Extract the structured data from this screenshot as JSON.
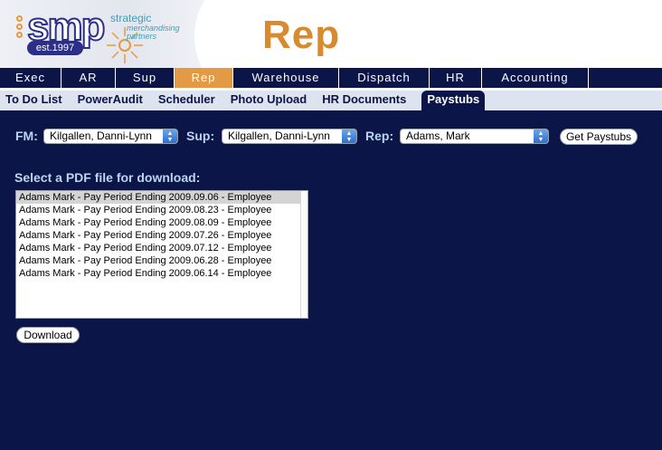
{
  "logo": {
    "brand": "smp",
    "established": "est.1997",
    "tagline_1": "strategic",
    "tagline_2": "merchandising",
    "tagline_3": "partners"
  },
  "page_title": "Rep",
  "top_nav": {
    "tabs": [
      {
        "label": "Exec"
      },
      {
        "label": "AR"
      },
      {
        "label": "Sup"
      },
      {
        "label": "Rep",
        "active": true
      },
      {
        "label": "Warehouse"
      },
      {
        "label": "Dispatch"
      },
      {
        "label": "HR"
      },
      {
        "label": "Accounting"
      }
    ]
  },
  "sub_nav": {
    "tabs": [
      {
        "label": "To Do List"
      },
      {
        "label": "PowerAudit"
      },
      {
        "label": "Scheduler"
      },
      {
        "label": "Photo Upload"
      },
      {
        "label": "HR Documents"
      },
      {
        "label": "Paystubs",
        "active": true
      }
    ]
  },
  "filters": {
    "fm_label": "FM:",
    "fm_value": "Kilgallen, Danni-Lynn",
    "sup_label": "Sup:",
    "sup_value": "Kilgallen, Danni-Lynn",
    "rep_label": "Rep:",
    "rep_value": "Adams, Mark",
    "get_button": "Get Paystubs"
  },
  "files": {
    "prompt": "Select a PDF file for download:",
    "items": [
      "Adams Mark - Pay Period Ending 2009.09.06 - Employee",
      "Adams Mark - Pay Period Ending 2009.08.23 - Employee",
      "Adams Mark - Pay Period Ending 2009.08.09 - Employee",
      "Adams Mark - Pay Period Ending 2009.07.26 - Employee",
      "Adams Mark - Pay Period Ending 2009.07.12 - Employee",
      "Adams Mark - Pay Period Ending 2009.06.28 - Employee",
      "Adams Mark - Pay Period Ending 2009.06.14 - Employee"
    ],
    "selected_index": 0,
    "download_button": "Download"
  },
  "colors": {
    "background": "#0b1548",
    "accent": "#e49a44",
    "label": "#bcd4f0"
  }
}
